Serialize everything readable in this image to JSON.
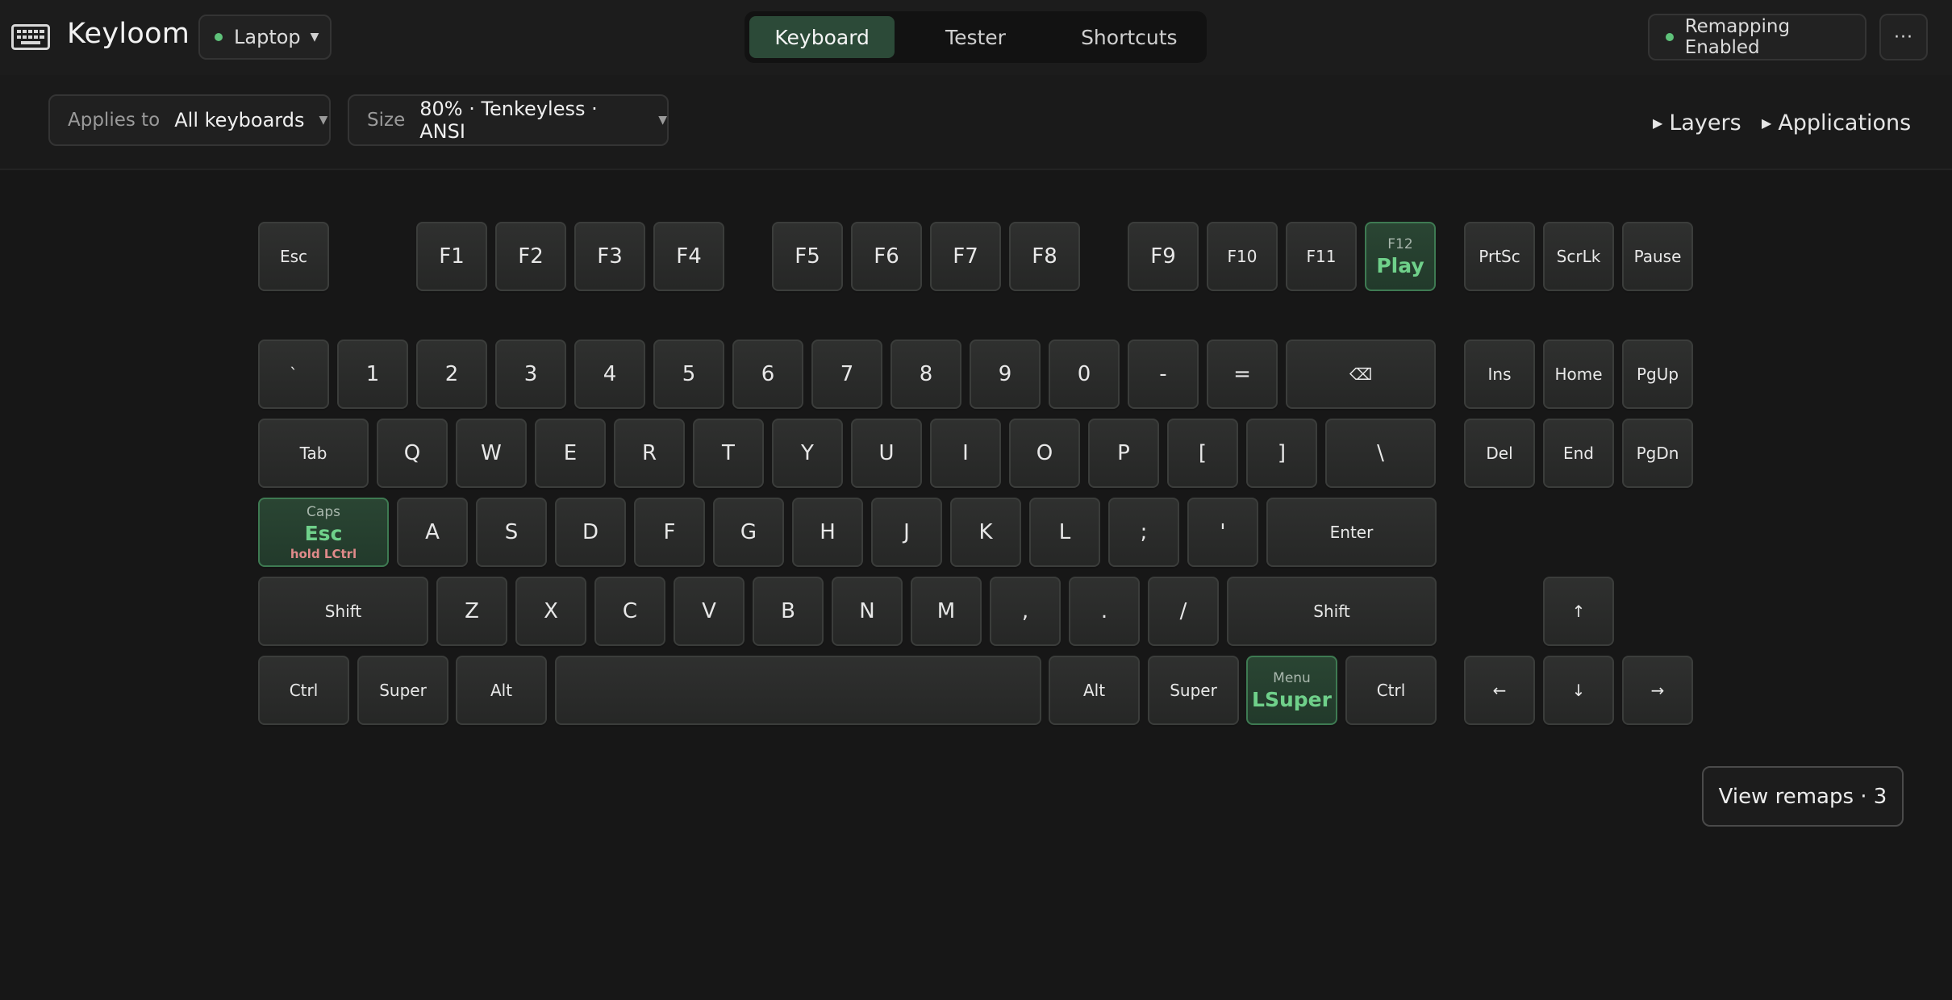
{
  "header": {
    "app_title": "Keyloom",
    "app_icon": "keyboard-icon",
    "device": "Laptop",
    "tabs": [
      {
        "label": "Keyboard",
        "active": true
      },
      {
        "label": "Tester",
        "active": false
      },
      {
        "label": "Shortcuts",
        "active": false
      }
    ],
    "status": "Remapping Enabled",
    "status_color": "#5fc27a",
    "more_label": "···"
  },
  "filters": {
    "applies_label": "Applies to",
    "applies_value": "All keyboards",
    "size_label": "Size",
    "size_value": "80% · Tenkeyless · ANSI",
    "layers_label": "Layers",
    "applications_label": "Applications"
  },
  "keyboard": {
    "remap_color": "#6fd08a",
    "keys": [
      {
        "label": "Esc"
      },
      {
        "label": "F1"
      },
      {
        "label": "F2"
      },
      {
        "label": "F3"
      },
      {
        "label": "F4"
      },
      {
        "label": "F5"
      },
      {
        "label": "F6"
      },
      {
        "label": "F7"
      },
      {
        "label": "F8"
      },
      {
        "label": "F9"
      },
      {
        "label": "F10"
      },
      {
        "label": "F11"
      },
      {
        "label": "F12",
        "remap": "Play"
      },
      {
        "label": "PrtSc"
      },
      {
        "label": "ScrLk"
      },
      {
        "label": "Pause"
      },
      {
        "label": "`"
      },
      {
        "label": "1"
      },
      {
        "label": "2"
      },
      {
        "label": "3"
      },
      {
        "label": "4"
      },
      {
        "label": "5"
      },
      {
        "label": "6"
      },
      {
        "label": "7"
      },
      {
        "label": "8"
      },
      {
        "label": "9"
      },
      {
        "label": "0"
      },
      {
        "label": "-"
      },
      {
        "label": "="
      },
      {
        "label": "⌫",
        "icon": "backspace-icon"
      },
      {
        "label": "Ins"
      },
      {
        "label": "Home"
      },
      {
        "label": "PgUp"
      },
      {
        "label": "Tab"
      },
      {
        "label": "Q"
      },
      {
        "label": "W"
      },
      {
        "label": "E"
      },
      {
        "label": "R"
      },
      {
        "label": "T"
      },
      {
        "label": "Y"
      },
      {
        "label": "U"
      },
      {
        "label": "I"
      },
      {
        "label": "O"
      },
      {
        "label": "P"
      },
      {
        "label": "["
      },
      {
        "label": "]"
      },
      {
        "label": "\\"
      },
      {
        "label": "Del"
      },
      {
        "label": "End"
      },
      {
        "label": "PgDn"
      },
      {
        "label": "Caps",
        "remap": "Esc",
        "hold": "hold LCtrl"
      },
      {
        "label": "A"
      },
      {
        "label": "S"
      },
      {
        "label": "D"
      },
      {
        "label": "F"
      },
      {
        "label": "G"
      },
      {
        "label": "H"
      },
      {
        "label": "J"
      },
      {
        "label": "K"
      },
      {
        "label": "L"
      },
      {
        "label": ";"
      },
      {
        "label": "'"
      },
      {
        "label": "Enter"
      },
      {
        "label": "Shift"
      },
      {
        "label": "Z"
      },
      {
        "label": "X"
      },
      {
        "label": "C"
      },
      {
        "label": "V"
      },
      {
        "label": "B"
      },
      {
        "label": "N"
      },
      {
        "label": "M"
      },
      {
        "label": ","
      },
      {
        "label": "."
      },
      {
        "label": "/"
      },
      {
        "label": "Shift"
      },
      {
        "label": "↑",
        "icon": "arrow-up-icon"
      },
      {
        "label": "Ctrl"
      },
      {
        "label": "Super"
      },
      {
        "label": "Alt"
      },
      {
        "label": ""
      },
      {
        "label": "Alt"
      },
      {
        "label": "Super"
      },
      {
        "label": "Menu",
        "remap": "LSuper"
      },
      {
        "label": "Ctrl"
      },
      {
        "label": "←",
        "icon": "arrow-left-icon"
      },
      {
        "label": "↓",
        "icon": "arrow-down-icon"
      },
      {
        "label": "→",
        "icon": "arrow-right-icon"
      }
    ]
  },
  "footer": {
    "view_remaps_label": "View remaps · 3"
  }
}
